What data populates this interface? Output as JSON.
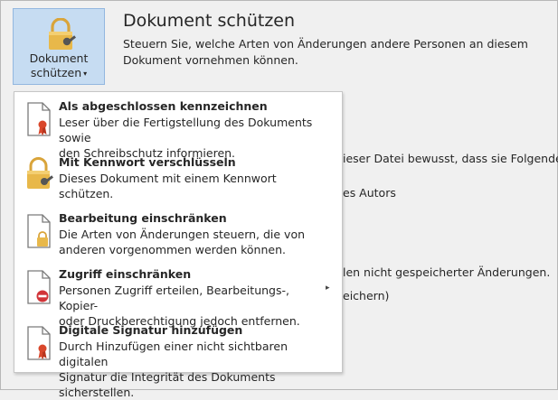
{
  "protect_button": {
    "line1": "Dokument",
    "line2": "schützen",
    "caret": "▾"
  },
  "section": {
    "title": "Dokument schützen",
    "description": "Steuern Sie, welche Arten von Änderungen andere Personen an diesem Dokument vornehmen können."
  },
  "background_fragments": [
    "ieser Datei bewusst, dass sie Folgendes",
    "es Autors",
    "len nicht gespeicherter Änderungen.",
    "eichern)"
  ],
  "menu": {
    "items": [
      {
        "icon": "document-ribbon-icon",
        "title": "Als abgeschlossen kennzeichnen",
        "desc_line1": "Leser über die Fertigstellung des Dokuments sowie",
        "desc_line2": "den Schreibschutz informieren.",
        "has_submenu": false
      },
      {
        "icon": "lock-key-icon",
        "title": "Mit Kennwort verschlüsseln",
        "desc_line1": "Dieses Dokument mit einem Kennwort schützen.",
        "desc_line2": "",
        "has_submenu": false
      },
      {
        "icon": "document-lock-icon",
        "title": "Bearbeitung einschränken",
        "desc_line1": "Die Arten von Änderungen steuern, die von",
        "desc_line2": "anderen vorgenommen werden können.",
        "has_submenu": false
      },
      {
        "icon": "document-restricted-icon",
        "title": "Zugriff einschränken",
        "desc_line1": "Personen Zugriff erteilen, Bearbeitungs-, Kopier-",
        "desc_line2": "oder Druckberechtigung jedoch entfernen.",
        "has_submenu": true
      },
      {
        "icon": "document-signature-icon",
        "title": "Digitale Signatur hinzufügen",
        "desc_line1": "Durch Hinzufügen einer nicht sichtbaren digitalen",
        "desc_line2": "Signatur die Integrität des Dokuments sicherstellen.",
        "has_submenu": false
      }
    ],
    "submenu_arrow": "▸"
  },
  "colors": {
    "button_bg": "#c6dcf2",
    "button_border": "#93b7df",
    "lock_gold": "#e8b84a",
    "ribbon_red": "#d9472b",
    "restricted_red": "#d13438"
  }
}
